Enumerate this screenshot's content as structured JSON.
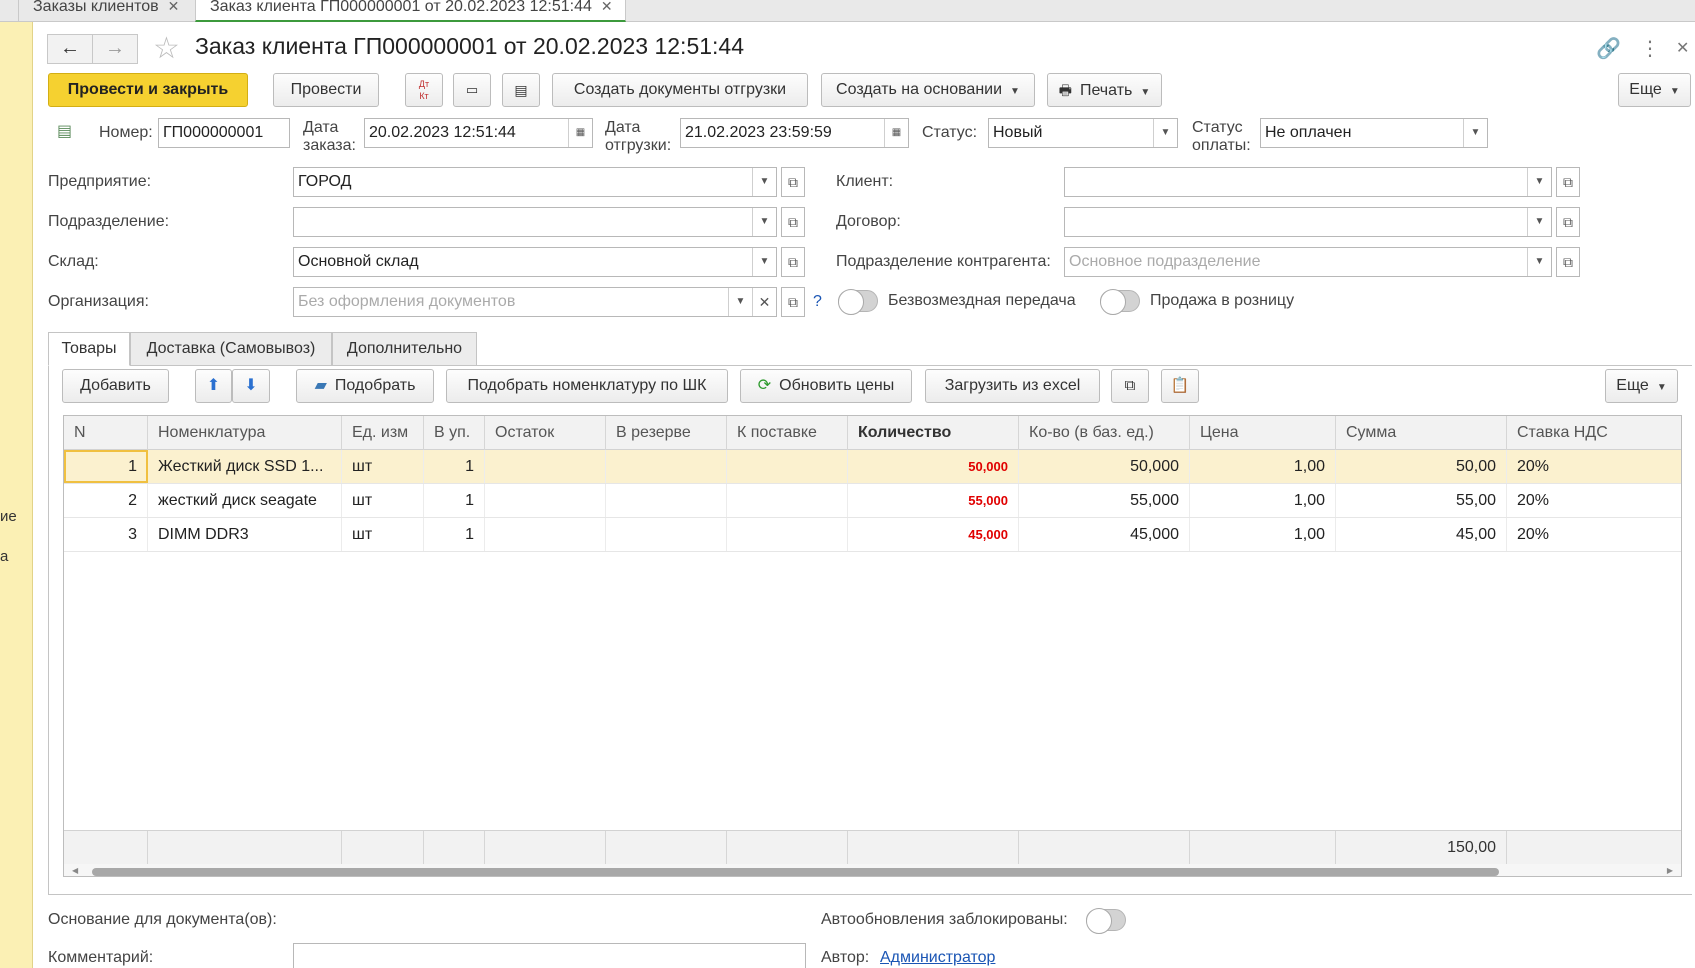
{
  "window_tabs": [
    {
      "label": "Заказы клиентов"
    },
    {
      "label": "Заказ клиента ГП000000001 от 20.02.2023 12:51:44"
    }
  ],
  "left_panel": {
    "items": [
      "ие",
      "а"
    ]
  },
  "header": {
    "title": "Заказ клиента ГП000000001 от 20.02.2023 12:51:44"
  },
  "toolbar": {
    "post_and_close": "Провести и закрыть",
    "post": "Провести",
    "dt_kt_top": "Дт",
    "dt_kt_bottom": "Кт",
    "create_shipment_docs": "Создать документы отгрузки",
    "create_based_on": "Создать на основании",
    "print": "Печать",
    "more": "Еще"
  },
  "doc": {
    "number_label": "Номер:",
    "number": "ГП000000001",
    "order_date_label_1": "Дата",
    "order_date_label_2": "заказа:",
    "order_date": "20.02.2023 12:51:44",
    "ship_date_label_1": "Дата",
    "ship_date_label_2": "отгрузки:",
    "ship_date": "21.02.2023 23:59:59",
    "status_label": "Статус:",
    "status": "Новый",
    "pay_status_label_1": "Статус",
    "pay_status_label_2": "оплаты:",
    "pay_status": "Не оплачен"
  },
  "form": {
    "enterprise_label": "Предприятие:",
    "enterprise": "ГОРОД",
    "division_label": "Подразделение:",
    "division": "",
    "warehouse_label": "Склад:",
    "warehouse": "Основной склад",
    "organization_label": "Организация:",
    "organization_placeholder": "Без оформления документов",
    "help": "?",
    "client_label": "Клиент:",
    "client": "",
    "contract_label": "Договор:",
    "contract": "",
    "counterparty_division_label": "Подразделение контрагента:",
    "counterparty_division_placeholder": "Основное подразделение",
    "free_transfer_label": "Безвозмездная передача",
    "retail_sale_label": "Продажа в розницу"
  },
  "tabs": [
    {
      "label": "Товары"
    },
    {
      "label": "Доставка (Самовывоз)"
    },
    {
      "label": "Дополнительно"
    }
  ],
  "goods_toolbar": {
    "add": "Добавить",
    "pick": "Подобрать",
    "pick_by_barcode": "Подобрать номенклатуру по ШК",
    "update_prices": "Обновить цены",
    "load_excel": "Загрузить из excel",
    "more": "Еще"
  },
  "table": {
    "columns": [
      "N",
      "Номенклатура",
      "Ед. изм",
      "В уп.",
      "Остаток",
      "В резерве",
      "К поставке",
      "Количество",
      "Ко-во (в баз. ед.)",
      "Цена",
      "Сумма",
      "Ставка НДС"
    ],
    "rows": [
      [
        "1",
        "Жесткий диск SSD 1...",
        "шт",
        "1",
        "",
        "",
        "",
        "50,000",
        "50,000",
        "1,00",
        "50,00",
        "20%"
      ],
      [
        "2",
        "жесткий диск seagate",
        "шт",
        "1",
        "",
        "",
        "",
        "55,000",
        "55,000",
        "1,00",
        "55,00",
        "20%"
      ],
      [
        "3",
        "DIMM DDR3",
        "шт",
        "1",
        "",
        "",
        "",
        "45,000",
        "45,000",
        "1,00",
        "45,00",
        "20%"
      ]
    ],
    "total_sum": "150,00"
  },
  "bottom": {
    "basis_label": "Основание для документа(ов):",
    "autoupdate_label": "Автообновления заблокированы:",
    "comment_label": "Комментарий:",
    "author_label": "Автор:",
    "author": "Администратор"
  }
}
